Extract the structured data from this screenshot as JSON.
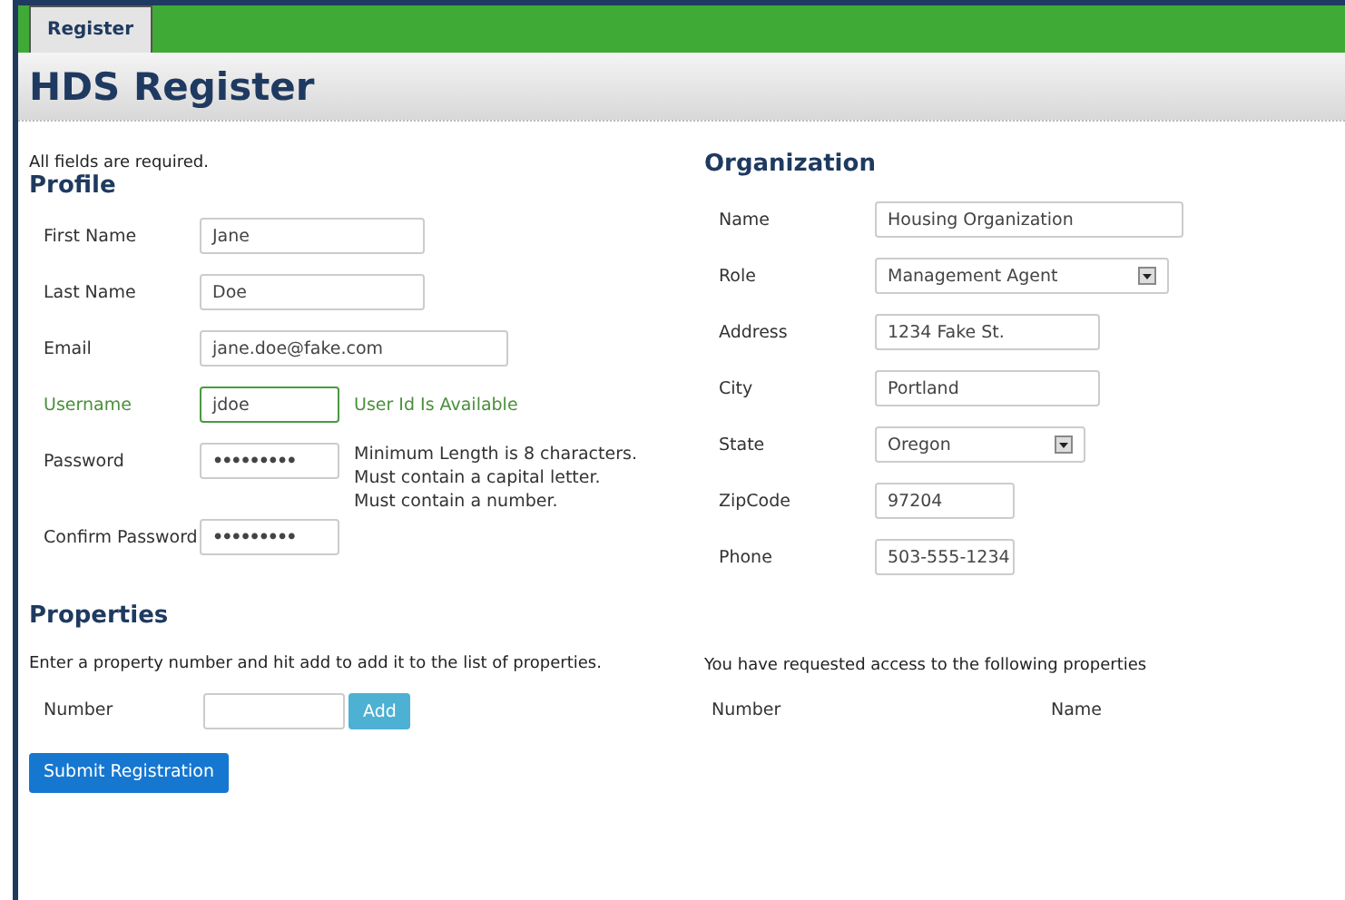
{
  "tabs": [
    {
      "label": "Register",
      "selected": true
    }
  ],
  "title": "HDS Register",
  "note": "All fields are required.",
  "profile": {
    "heading": "Profile",
    "fields": [
      {
        "label": "First Name",
        "kind": "text",
        "value": "Jane",
        "valid": false
      },
      {
        "label": "Last Name",
        "kind": "text",
        "value": "Doe",
        "valid": false
      },
      {
        "label": "Email",
        "kind": "text",
        "value": "jane.doe@fake.com",
        "valid": false
      },
      {
        "label": "Username",
        "kind": "text",
        "value": "jdoe",
        "valid": true,
        "message": "User Id Is Available"
      },
      {
        "label": "Password",
        "kind": "password",
        "value": "•••••••••",
        "valid": false,
        "hints": [
          "Minimum Length is 8 characters.",
          "Must contain a capital letter.",
          "Must contain a number."
        ]
      },
      {
        "label": "Confirm Password",
        "kind": "password",
        "value": "•••••••••",
        "valid": false
      }
    ]
  },
  "organization": {
    "heading": "Organization",
    "fields": [
      {
        "label": "Name",
        "kind": "text",
        "value": "Housing Organization"
      },
      {
        "label": "Role",
        "kind": "select",
        "value": "Management Agent"
      },
      {
        "label": "Address",
        "kind": "text",
        "value": "1234 Fake St."
      },
      {
        "label": "City",
        "kind": "text",
        "value": "Portland"
      },
      {
        "label": "State",
        "kind": "select",
        "value": "Oregon"
      },
      {
        "label": "ZipCode",
        "kind": "text",
        "value": "97204"
      },
      {
        "label": "Phone",
        "kind": "text",
        "value": "503-555-1234"
      }
    ]
  },
  "properties": {
    "heading": "Properties",
    "instructions": "Enter a property number and hit add to add it to the list of properties.",
    "number_label": "Number",
    "add_button": "Add",
    "requested_text": "You have requested access to the following properties",
    "columns": [
      "Number",
      "Name"
    ]
  },
  "submit_button": "Submit Registration"
}
